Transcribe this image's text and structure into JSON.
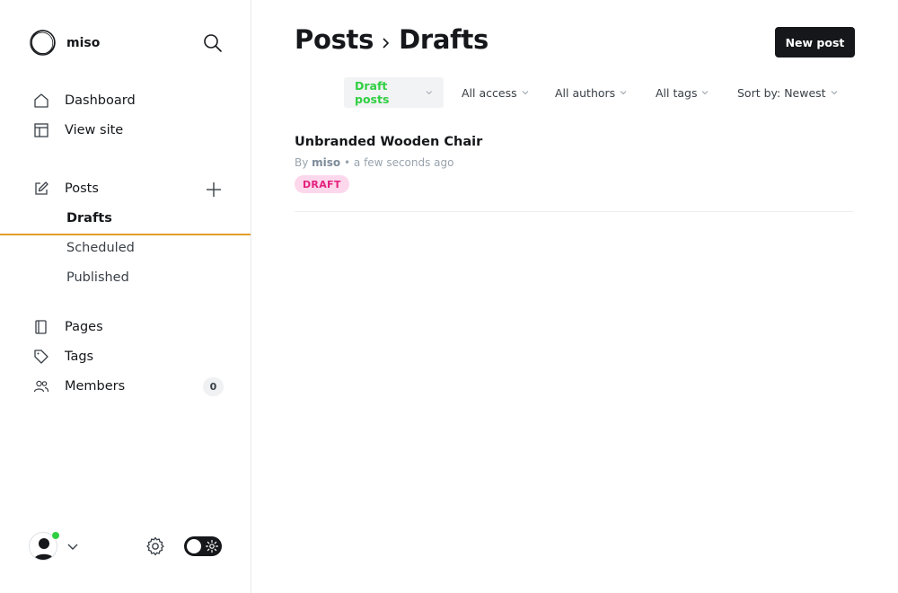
{
  "site": {
    "name": "miso"
  },
  "sidebar": {
    "items": [
      {
        "label": "Dashboard",
        "icon": "home-icon"
      },
      {
        "label": "View site",
        "icon": "layout-icon"
      },
      {
        "label": "Posts",
        "icon": "pencil-square-icon"
      },
      {
        "label": "Pages",
        "icon": "page-icon"
      },
      {
        "label": "Tags",
        "icon": "tag-icon"
      },
      {
        "label": "Members",
        "icon": "members-icon",
        "count": "0"
      }
    ],
    "post_subitems": [
      {
        "label": "Drafts",
        "active": true
      },
      {
        "label": "Scheduled"
      },
      {
        "label": "Published"
      }
    ]
  },
  "header": {
    "breadcrumb_parent": "Posts",
    "breadcrumb_current": "Drafts",
    "new_post_label": "New post"
  },
  "filters": [
    {
      "label": "Draft posts",
      "active": true
    },
    {
      "label": "All access"
    },
    {
      "label": "All authors"
    },
    {
      "label": "All tags"
    },
    {
      "label": "Sort by: Newest"
    }
  ],
  "posts": [
    {
      "title": "Unbranded Wooden Chair",
      "by": "By",
      "author": "miso",
      "time": "• a few seconds ago",
      "status": "DRAFT"
    }
  ],
  "colors": {
    "accent_green": "#30cf43",
    "active_underline": "#e09d2b",
    "draft_badge_bg": "#fdd8ec",
    "draft_badge_text": "#e3217e",
    "primary_button": "#15171a"
  }
}
